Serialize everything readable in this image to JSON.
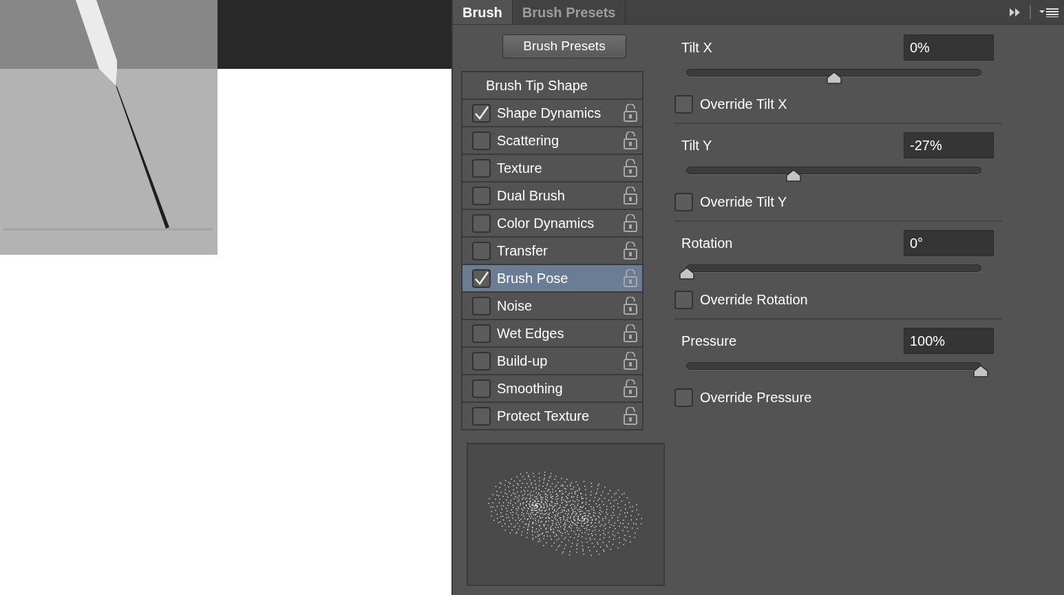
{
  "tabs": [
    {
      "label": "Brush",
      "selected": true
    },
    {
      "label": "Brush Presets",
      "selected": false
    }
  ],
  "presets_button": "Brush Presets",
  "brush_options": [
    {
      "kind": "header",
      "label": "Brush Tip Shape",
      "selected": false
    },
    {
      "kind": "option",
      "label": "Shape Dynamics",
      "checked": true,
      "selected": false
    },
    {
      "kind": "option",
      "label": "Scattering",
      "checked": false,
      "selected": false
    },
    {
      "kind": "option",
      "label": "Texture",
      "checked": false,
      "selected": false
    },
    {
      "kind": "option",
      "label": "Dual Brush",
      "checked": false,
      "selected": false
    },
    {
      "kind": "option",
      "label": "Color Dynamics",
      "checked": false,
      "selected": false
    },
    {
      "kind": "option",
      "label": "Transfer",
      "checked": false,
      "selected": false
    },
    {
      "kind": "option",
      "label": "Brush Pose",
      "checked": true,
      "selected": true
    },
    {
      "kind": "option",
      "label": "Noise",
      "checked": false,
      "selected": false
    },
    {
      "kind": "option",
      "label": "Wet Edges",
      "checked": false,
      "selected": false
    },
    {
      "kind": "option",
      "label": "Build-up",
      "checked": false,
      "selected": false
    },
    {
      "kind": "option",
      "label": "Smoothing",
      "checked": false,
      "selected": false
    },
    {
      "kind": "option",
      "label": "Protect Texture",
      "checked": false,
      "selected": false
    }
  ],
  "settings": [
    {
      "label": "Tilt X",
      "value": "0%",
      "level": 0.5,
      "override": {
        "label": "Override Tilt X",
        "checked": false
      }
    },
    {
      "label": "Tilt Y",
      "value": "-27%",
      "level": 0.364,
      "override": {
        "label": "Override Tilt Y",
        "checked": false
      }
    },
    {
      "label": "Rotation",
      "value": "0°",
      "level": 0,
      "override": {
        "label": "Override Rotation",
        "checked": false
      }
    },
    {
      "label": "Pressure",
      "value": "100%",
      "level": 1,
      "override": {
        "label": "Override Pressure",
        "checked": false
      }
    }
  ]
}
